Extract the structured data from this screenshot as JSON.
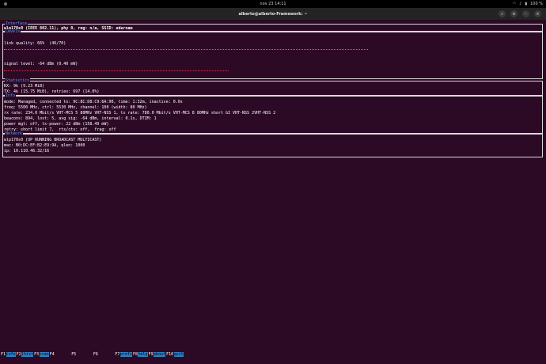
{
  "topbar": {
    "clock": "nov 23  14:11",
    "battery": "100 %"
  },
  "window": {
    "title": "alberto@alberto-Framework: ~"
  },
  "interface": {
    "title": "Interface",
    "line": "wlp170s0 (IEEE 802.11), phy 0, reg: n/a, SSID: eduroam"
  },
  "levels": {
    "title": "Levels",
    "link_quality": "link quality: 66%  (46/70)",
    "link_quality_fraction": 0.66,
    "signal_level": "signal level: -64 dBm (0.40 mW)"
  },
  "statistics": {
    "title": "Statistics",
    "rx": "RX: 9k (9.23 MiB)",
    "tx": "TX: 4k (15.75 MiB), retries: 697 (14.0%)"
  },
  "info": {
    "title": "Info",
    "lines": [
      "mode: Managed, connected to: 9C:8C:D8:C9:6A:90, time: 1:32m, inactive: 0.0s",
      "freq: 5500 MHz, ctrl: 5530 MHz, channel: 100 (width: 80 MHz)",
      "rx rate: 234.0 Mbit/s VHT-MCS 5 80MHz VHT-NSS 1, tx rate: 780.0 Mbit/s VHT-MCS 8 80MHz short GI VHT-NSS 2VHT-NSS 2",
      "beacons: 894, lost: 5, avg sig: -64 dBm, interval: 0.1s, DTIM: 1",
      "power mgt: off, tx-power: 22 dBm (158.49 mW)",
      "retry: short limit 7,  rts/cts: off,  frag: off"
    ]
  },
  "network": {
    "title": "Network",
    "lines": [
      "wlp170s0 (UP RUNNING BROADCAST MULTICAST)",
      "mac: B0:DC:EF:B2:E9:9A, qlen: 1000",
      "ip: 10.110.46.32/16"
    ]
  },
  "fkeys": [
    {
      "key": "F1",
      "label": "info"
    },
    {
      "key": "F2",
      "label": "lhist"
    },
    {
      "key": "F3",
      "label": "scan"
    },
    {
      "key": "F4",
      "label": ""
    },
    {
      "key": "F5",
      "label": ""
    },
    {
      "key": "F6",
      "label": ""
    },
    {
      "key": "F7",
      "label": "prefs"
    },
    {
      "key": "F8",
      "label": "help"
    },
    {
      "key": "F9",
      "label": "about"
    },
    {
      "key": "F10",
      "label": "quit"
    }
  ]
}
